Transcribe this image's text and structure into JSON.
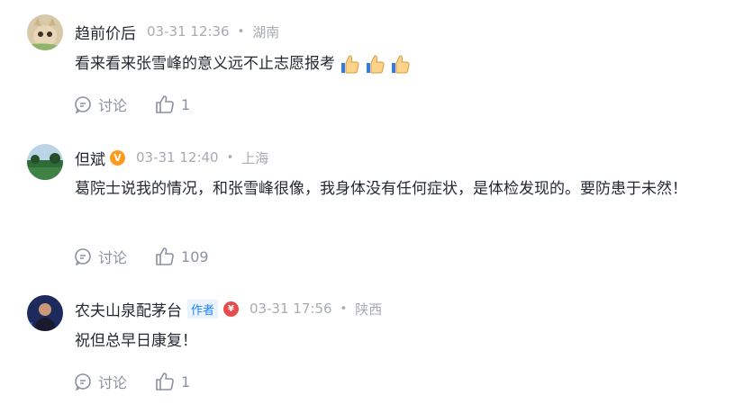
{
  "comments": [
    {
      "name": "趋前价后",
      "time": "03-31 12:36",
      "location": "湖南",
      "text": "看来看来张雪峰的意义远不止志愿报考",
      "emoji": "thumbs-up-emoji",
      "emoji_count": 3,
      "reply_label": "讨论",
      "likes": "1"
    },
    {
      "name": "但斌",
      "verified": "V",
      "time": "03-31 12:40",
      "location": "上海",
      "text": "葛院士说我的情况，和张雪峰很像，我身体没有任何症状，是体检发现的。要防患于未然！",
      "reply_label": "讨论",
      "likes": "109"
    },
    {
      "name": "农夫山泉配茅台",
      "author_tag": "作者",
      "badge": "¥",
      "time": "03-31 17:56",
      "location": "陕西",
      "text": "祝但总早日康复！",
      "reply_label": "讨论",
      "likes": "1"
    }
  ],
  "colors": {
    "meta": "#a8abb3",
    "action": "#8a919f",
    "author_tag": "#1e80ff",
    "verified": "#ff9a1a",
    "badge": "#e64c4c"
  }
}
